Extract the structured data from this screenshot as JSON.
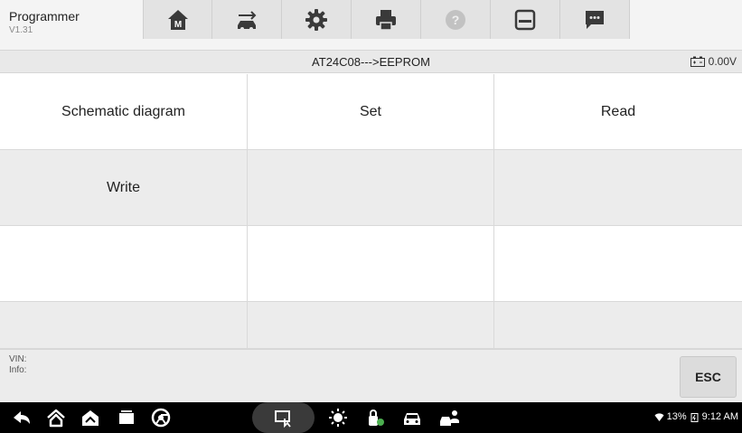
{
  "app": {
    "name": "Programmer",
    "version": "V1.31"
  },
  "toolbar": {
    "buttons": [
      {
        "icon": "home-icon"
      },
      {
        "icon": "vehicle-swap-icon"
      },
      {
        "icon": "settings-gear-icon"
      },
      {
        "icon": "printer-icon"
      },
      {
        "icon": "help-icon"
      },
      {
        "icon": "save-icon"
      },
      {
        "icon": "message-icon"
      }
    ]
  },
  "pathbar": {
    "title": "AT24C08--->EEPROM",
    "voltage": "0.00V"
  },
  "functions": [
    {
      "label": "Schematic diagram"
    },
    {
      "label": "Set"
    },
    {
      "label": "Read"
    },
    {
      "label": "Write"
    },
    {
      "label": ""
    },
    {
      "label": ""
    },
    {
      "label": ""
    },
    {
      "label": ""
    },
    {
      "label": ""
    },
    {
      "label": ""
    },
    {
      "label": ""
    },
    {
      "label": ""
    }
  ],
  "info": {
    "vin_label": "VIN:",
    "info_label": "Info:",
    "esc_label": "ESC"
  },
  "navbar": {
    "icons": [
      "back-icon",
      "home-icon",
      "autel-home-icon",
      "recent-apps-icon",
      "browser-icon",
      "remote-desktop-icon",
      "brightness-icon",
      "vci-icon",
      "car-icon",
      "car-user-icon"
    ],
    "status": {
      "battery": "13%",
      "time": "9:12 AM"
    }
  },
  "colors": {
    "toolbar_bg": "#f4f4f4",
    "button_bg": "#e3e3e3",
    "grid_gray": "#ececec",
    "navbar_bg": "#000000"
  }
}
